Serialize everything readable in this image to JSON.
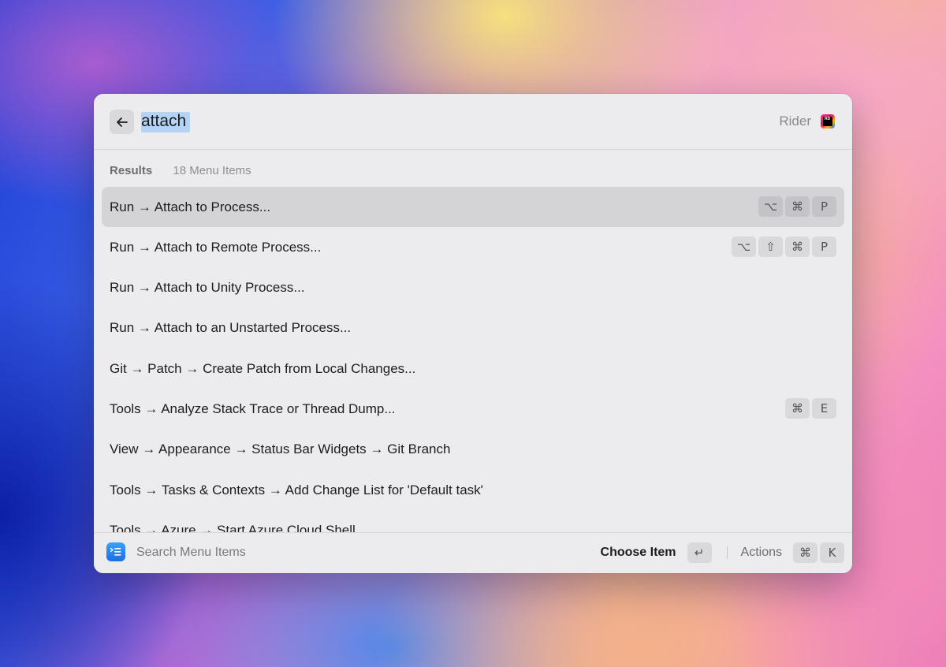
{
  "search": {
    "value": "attach",
    "app_name": "Rider"
  },
  "results": {
    "title": "Results",
    "count": "18 Menu Items",
    "items": [
      {
        "label": "Run → Attach to Process...",
        "keys": [
          "⌥",
          "⌘",
          "P"
        ],
        "selected": true
      },
      {
        "label": "Run → Attach to Remote Process...",
        "keys": [
          "⌥",
          "⇧",
          "⌘",
          "P"
        ]
      },
      {
        "label": "Run → Attach to Unity Process...",
        "keys": []
      },
      {
        "label": "Run → Attach to an Unstarted Process...",
        "keys": []
      },
      {
        "label": "Git → Patch → Create Patch from Local Changes...",
        "keys": []
      },
      {
        "label": "Tools → Analyze Stack Trace or Thread Dump...",
        "keys": [
          "⌘",
          "E"
        ]
      },
      {
        "label": "View → Appearance → Status Bar Widgets → Git Branch",
        "keys": []
      },
      {
        "label": "Tools → Tasks & Contexts → Add Change List for 'Default task'",
        "keys": []
      },
      {
        "label": "Tools → Azure → Start Azure Cloud Shell",
        "keys": []
      }
    ]
  },
  "footer": {
    "title": "Search Menu Items",
    "primary_action": "Choose Item",
    "primary_key": "↵",
    "actions_label": "Actions",
    "actions_keys": [
      "⌘",
      "K"
    ]
  },
  "icons": {
    "back": "arrow-left-icon",
    "app": "rider-app-icon",
    "extension": "menu-search-extension-icon"
  },
  "colors": {
    "selection_highlight": "#b4d3f5",
    "selected_row": "#d4d4d7",
    "key_cap": "#d9d9dc"
  }
}
